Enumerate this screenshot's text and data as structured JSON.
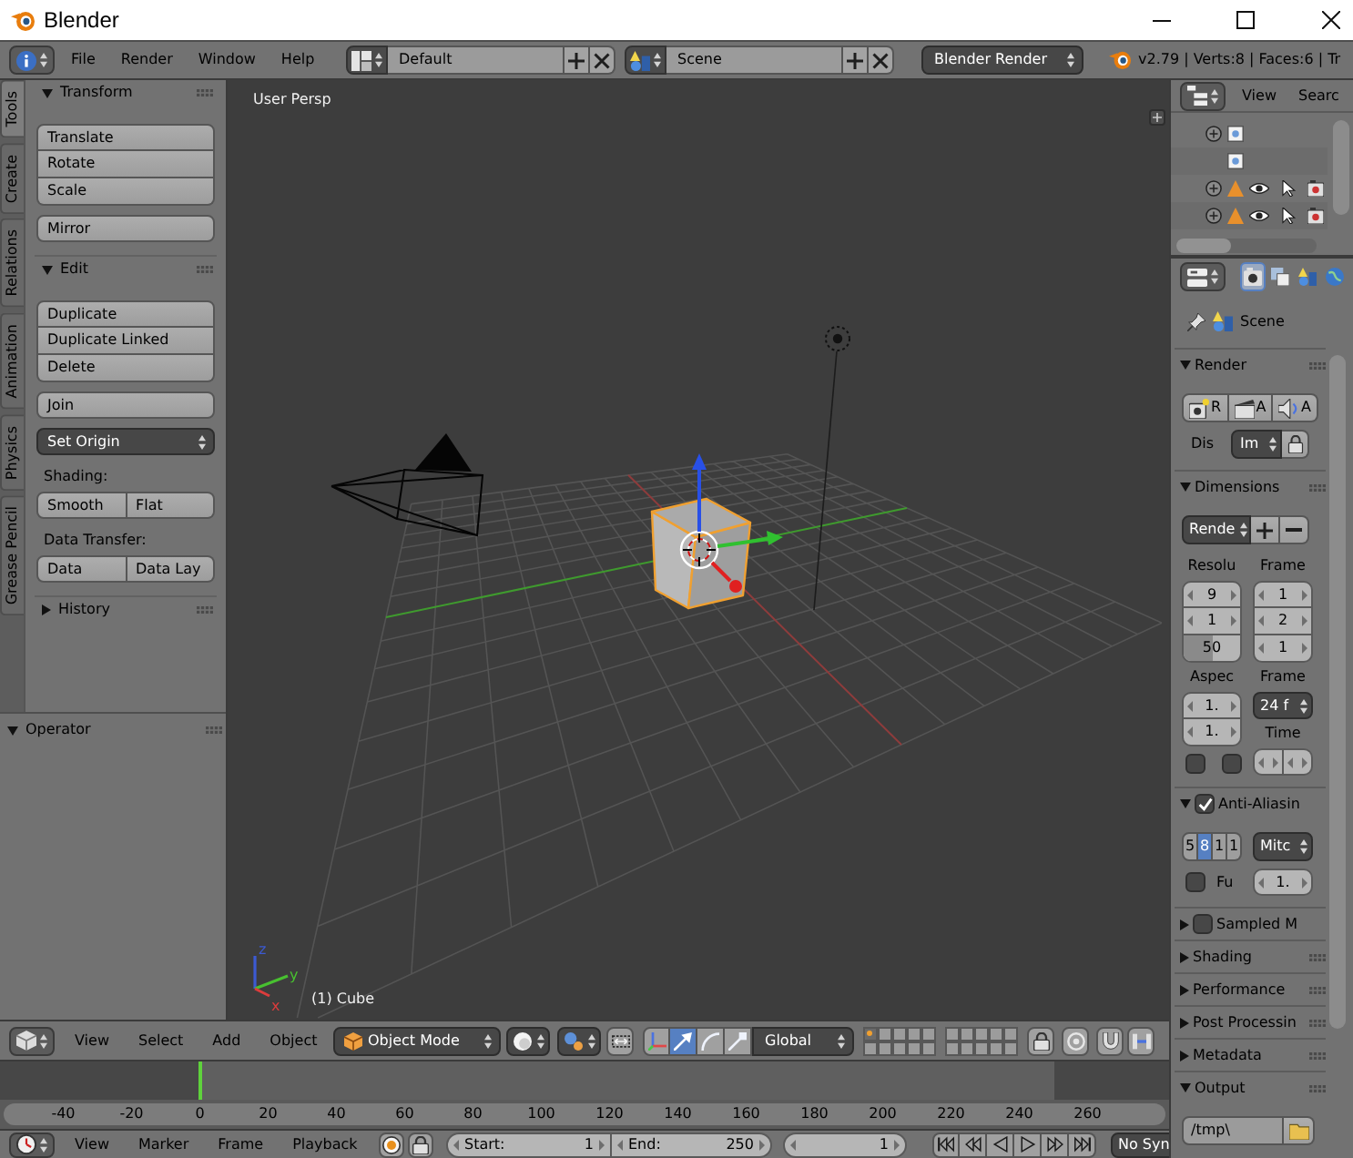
{
  "window": {
    "title": "Blender"
  },
  "info_header": {
    "menus": [
      "File",
      "Render",
      "Window",
      "Help"
    ],
    "screen_layout": "Default",
    "scene": "Scene",
    "render_engine": "Blender Render",
    "stats": "v2.79 | Verts:8 | Faces:6 | Tr"
  },
  "tool_shelf": {
    "tabs": [
      {
        "label": "Tools",
        "selected": true
      },
      {
        "label": "Create",
        "selected": false
      },
      {
        "label": "Relations",
        "selected": false
      },
      {
        "label": "Animation",
        "selected": false
      },
      {
        "label": "Physics",
        "selected": false
      },
      {
        "label": "Grease Pencil",
        "selected": false
      }
    ],
    "panels": [
      {
        "title": "Transform",
        "expanded": true,
        "items": [
          {
            "kind": "stack",
            "buttons": [
              "Translate",
              "Rotate",
              "Scale"
            ]
          },
          {
            "kind": "stack",
            "buttons": [
              "Mirror"
            ]
          }
        ]
      },
      {
        "title": "Edit",
        "expanded": true,
        "items": [
          {
            "kind": "stack",
            "buttons": [
              "Duplicate",
              "Duplicate Linked",
              "Delete"
            ]
          },
          {
            "kind": "stack",
            "buttons": [
              "Join"
            ]
          },
          {
            "kind": "dropdown",
            "label": "Set Origin"
          },
          {
            "kind": "label",
            "label": "Shading:"
          },
          {
            "kind": "row",
            "buttons": [
              "Smooth",
              "Flat"
            ]
          },
          {
            "kind": "label",
            "label": "Data Transfer:"
          },
          {
            "kind": "row",
            "buttons": [
              "Data",
              "Data Lay"
            ]
          }
        ]
      },
      {
        "title": "History",
        "expanded": false
      }
    ],
    "operator_panel": {
      "title": "Operator",
      "expanded": true
    }
  },
  "viewport": {
    "view_name": "User Persp",
    "axes": [
      {
        "label": "z",
        "color": "#3c5ad2"
      },
      {
        "label": "y",
        "color": "#48c030"
      },
      {
        "label": "x",
        "color": "#dc3c3c"
      }
    ],
    "object_label": "(1) Cube"
  },
  "view3d_header": {
    "menus": [
      "View",
      "Select",
      "Add",
      "Object"
    ],
    "mode": "Object Mode",
    "manipulators": [
      {
        "kind": "toggle",
        "selected": false
      },
      {
        "kind": "translate",
        "selected": true
      },
      {
        "kind": "rotate",
        "selected": false
      },
      {
        "kind": "scale",
        "selected": false
      }
    ],
    "orientation": "Global",
    "layers": [
      {
        "selected": true,
        "used": true
      },
      {
        "selected": false,
        "used": false
      },
      {
        "selected": false,
        "used": false
      },
      {
        "selected": false,
        "used": false
      },
      {
        "selected": false,
        "used": false
      },
      {
        "selected": false,
        "used": false
      },
      {
        "selected": false,
        "used": false
      },
      {
        "selected": false,
        "used": false
      },
      {
        "selected": false,
        "used": false
      },
      {
        "selected": false,
        "used": false
      },
      {
        "selected": false,
        "used": false
      },
      {
        "selected": false,
        "used": false
      },
      {
        "selected": false,
        "used": false
      },
      {
        "selected": false,
        "used": false
      },
      {
        "selected": false,
        "used": false
      },
      {
        "selected": false,
        "used": false
      },
      {
        "selected": false,
        "used": false
      },
      {
        "selected": false,
        "used": false
      },
      {
        "selected": false,
        "used": false
      },
      {
        "selected": false,
        "used": false
      }
    ]
  },
  "timeline": {
    "ruler_labels": [
      "-40",
      "-20",
      "0",
      "20",
      "40",
      "60",
      "80",
      "100",
      "120",
      "140",
      "160",
      "180",
      "200",
      "220",
      "240",
      "260"
    ],
    "playhead": {
      "level": 0.171
    }
  },
  "timeline_header": {
    "menus": [
      "View",
      "Marker",
      "Frame",
      "Playback"
    ],
    "start": {
      "label": "Start:",
      "value": "1"
    },
    "end": {
      "label": "End:",
      "value": "250"
    },
    "current_frame": "1",
    "sync": "No Syn"
  },
  "outliner": {
    "menus": [
      "View",
      "Searc"
    ],
    "rows": [
      {
        "kind": "data",
        "expandable": true
      },
      {
        "kind": "data",
        "expandable": false
      },
      {
        "kind": "object",
        "expandable": true
      },
      {
        "kind": "object",
        "expandable": true
      }
    ]
  },
  "properties": {
    "tabs": [
      {
        "kind": "render",
        "selected": true
      },
      {
        "kind": "render_layers",
        "selected": false
      },
      {
        "kind": "scene",
        "selected": false
      },
      {
        "kind": "world",
        "selected": false
      }
    ],
    "context": "Scene",
    "panels": [
      {
        "kind": "render",
        "title": "Render",
        "expanded": true,
        "buttons": [
          {
            "kind": "still",
            "label": "R"
          },
          {
            "kind": "animation",
            "label": "A"
          },
          {
            "kind": "audio",
            "label": "A"
          }
        ],
        "display": {
          "label": "Dis",
          "value": "Im"
        }
      },
      {
        "kind": "dimensions",
        "title": "Dimensions",
        "expanded": true,
        "preset": "Rende",
        "resolution": {
          "label": "Resolu",
          "values": [
            "9",
            "1"
          ],
          "percentage": {
            "value": "50",
            "level": 0.5
          }
        },
        "frame_range": {
          "label": "Frame",
          "values": [
            "1",
            "2",
            "1"
          ]
        },
        "aspect": {
          "label": "Aspec",
          "values": [
            "1.",
            "1."
          ]
        },
        "border": [
          {
            "checked": false
          },
          {
            "checked": false
          }
        ],
        "frame_rate": {
          "label": "Frame",
          "value": "24 f"
        },
        "time": {
          "label": "Time"
        }
      },
      {
        "kind": "antialiasing",
        "title": "Anti-Aliasin",
        "expanded": true,
        "enabled": true,
        "samples": [
          {
            "label": "5",
            "selected": false
          },
          {
            "label": "8",
            "selected": true
          },
          {
            "label": "1",
            "selected": false
          },
          {
            "label": "1",
            "selected": false
          }
        ],
        "filter": "Mitc",
        "full_sample": {
          "label": "Fu",
          "checked": false
        },
        "filter_size": "1."
      },
      {
        "kind": "toggle",
        "title": "Sampled M",
        "expanded": false,
        "enabled": false
      },
      {
        "kind": "plain",
        "title": "Shading",
        "expanded": false
      },
      {
        "kind": "plain",
        "title": "Performance",
        "expanded": false
      },
      {
        "kind": "plain",
        "title": "Post Processin",
        "expanded": false
      },
      {
        "kind": "plain",
        "title": "Metadata",
        "expanded": false
      },
      {
        "kind": "output",
        "title": "Output",
        "expanded": true,
        "path": "/tmp\\"
      }
    ]
  }
}
